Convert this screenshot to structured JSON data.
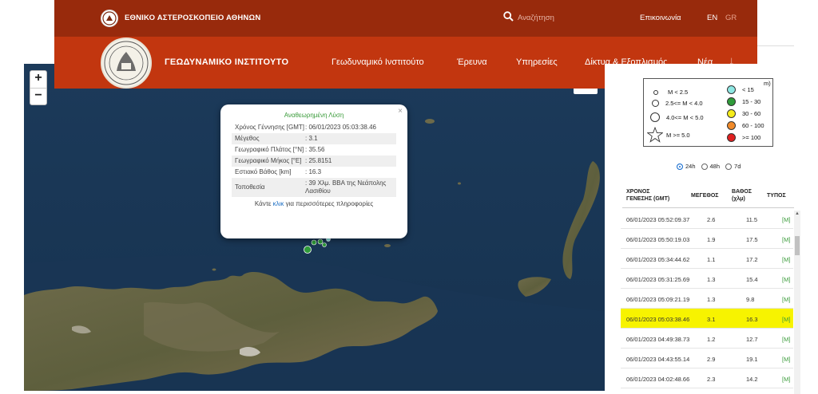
{
  "header": {
    "observatory": "ΕΘΝΙΚΟ ΑΣΤΕΡΟΣΚΟΠΕΙΟ ΑΘΗΝΩΝ",
    "search_placeholder": "Αναζήτηση",
    "contact": "Επικοινωνία",
    "lang_en": "EN",
    "lang_gr": "GR",
    "institute": "ΓΕΩΔΥΝΑΜΙΚΟ ΙΝΣΤΙΤΟΥΤΟ",
    "nav": [
      "Γεωδυναμικό Ινστιτούτο",
      "Έρευνα",
      "Υπηρεσίες",
      "Δίκτυα & Εξοπλισμός",
      "Νέα"
    ],
    "nav_more": "↓"
  },
  "map": {
    "zoom_in": "+",
    "zoom_out": "−"
  },
  "popup": {
    "close": "×",
    "title": "Αναθεωρημένη Λύση",
    "rows": [
      {
        "k": "Χρόνος Γέννησης [GMT]",
        "v": ": 06/01/2023 05:03:38.46"
      },
      {
        "k": "Μέγεθος",
        "v": ": 3.1"
      },
      {
        "k": "Γεωγραφικό Πλάτος [°N]",
        "v": ": 35.56"
      },
      {
        "k": "Γεωγραφικό Μήκος [°E]",
        "v": ": 25.8151"
      },
      {
        "k": "Εστιακό Βάθος [km]",
        "v": ": 16.3"
      },
      {
        "k": "Τοποθεσία",
        "v": ": 39 Χλμ. ΒΒΑ της Νεάπολης Λασιθίου"
      }
    ],
    "foot_pre": "Κάντε ",
    "foot_link": "κλικ",
    "foot_post": " για περισσότερες πληροφορίες"
  },
  "legend": {
    "corner": "m)",
    "magnitudes": [
      "M < 2.5",
      "2.5<= M < 4.0",
      "4.0<= M < 5.0",
      "M >= 5.0"
    ],
    "depths": [
      "< 15",
      "15 - 30",
      "30 - 60",
      "60 - 100",
      ">= 100"
    ],
    "depth_colors": [
      "#8ee7e3",
      "#2f9b3a",
      "#f5ec1a",
      "#f08a2a",
      "#e02020"
    ]
  },
  "filters": {
    "options": [
      "24h",
      "48h",
      "7d"
    ],
    "selected": "24h"
  },
  "table": {
    "headers": {
      "time_line1": "ΧΡΟΝΟΣ",
      "time_line2": "ΓΕΝΕΣΗΣ (GMT)",
      "magnitude": "ΜΕΓΕΘΟΣ",
      "depth_line1": "ΒΑΘΟΣ",
      "depth_line2": "(χλμ)",
      "type": "ΤΥΠΟΣ"
    },
    "rows": [
      {
        "time": "06/01/2023 05:52:09.37",
        "mag": "2.6",
        "depth": "11.5",
        "type": "[M]"
      },
      {
        "time": "06/01/2023 05:50:19.03",
        "mag": "1.9",
        "depth": "17.5",
        "type": "[M]"
      },
      {
        "time": "06/01/2023 05:34:44.62",
        "mag": "1.1",
        "depth": "17.2",
        "type": "[M]"
      },
      {
        "time": "06/01/2023 05:31:25.69",
        "mag": "1.3",
        "depth": "15.4",
        "type": "[M]"
      },
      {
        "time": "06/01/2023 05:09:21.19",
        "mag": "1.3",
        "depth": "9.8",
        "type": "[M]"
      },
      {
        "time": "06/01/2023 05:03:38.46",
        "mag": "3.1",
        "depth": "16.3",
        "type": "[M]",
        "highlight": true
      },
      {
        "time": "06/01/2023 04:49:38.73",
        "mag": "1.2",
        "depth": "12.7",
        "type": "[M]"
      },
      {
        "time": "06/01/2023 04:43:55.14",
        "mag": "2.9",
        "depth": "19.1",
        "type": "[M]"
      },
      {
        "time": "06/01/2023 04:02:48.66",
        "mag": "2.3",
        "depth": "14.2",
        "type": "[M]"
      }
    ],
    "highlight_color": "#f7f300"
  }
}
